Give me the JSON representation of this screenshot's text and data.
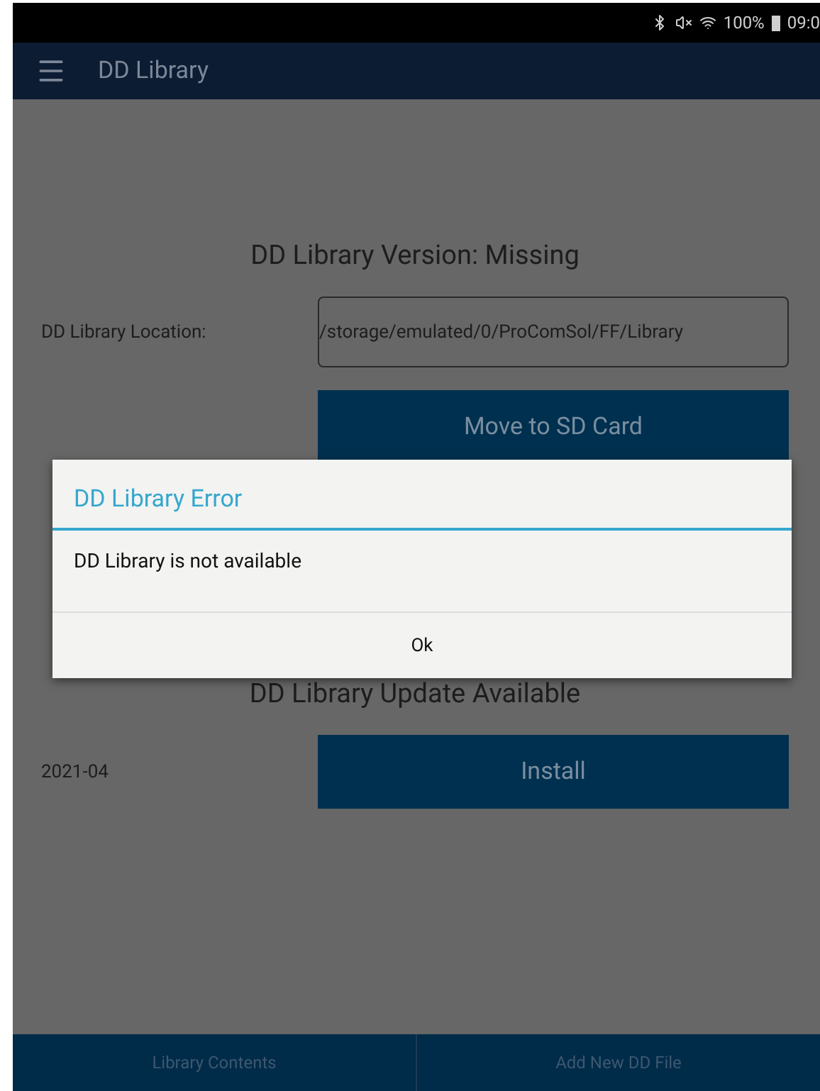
{
  "status_bar": {
    "battery": "100%",
    "time": "09:0"
  },
  "app_bar": {
    "title": "DD Library"
  },
  "version_heading": "DD Library Version: Missing",
  "location": {
    "label": "DD Library Location:",
    "value": "/storage/emulated/0/ProComSol/FF/Library"
  },
  "move_button": "Move to SD Card",
  "dialog": {
    "title": "DD Library Error",
    "message": "DD Library is not available",
    "button": "Ok"
  },
  "update_heading": "DD Library Update Available",
  "update": {
    "version": "2021-04",
    "button": "Install"
  },
  "bottom_tabs": [
    {
      "label": "Library Contents"
    },
    {
      "label": "Add New DD File"
    }
  ]
}
